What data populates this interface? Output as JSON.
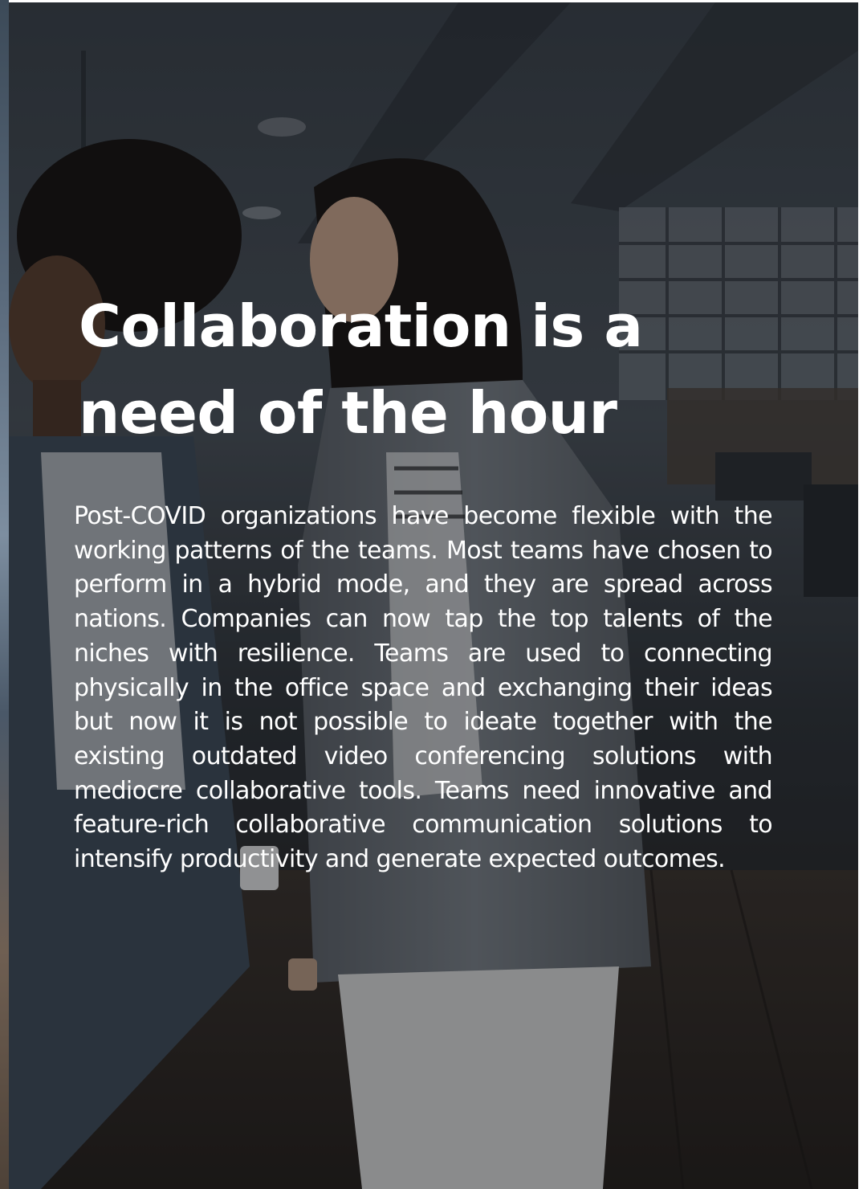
{
  "hero": {
    "title": "Collaboration is a need of the hour",
    "body": "Post-COVID organizations have become flexible with the working patterns of the teams. Most teams have chosen to perform in a hybrid mode, and they are spread across nations. Companies can now tap the top talents of the niches with resilience. Teams are used to connecting physically in the office space and exchanging their ideas but now it is not possible to ideate together with the existing outdated video conferencing solutions with mediocre collaborative tools. Teams need innovative and feature-rich collaborative communication solutions to intensify productivity and generate expected outcomes.",
    "background_image": "office-people-walking-photo",
    "colors": {
      "overlay": "#1a1e22",
      "text": "#ffffff"
    }
  }
}
